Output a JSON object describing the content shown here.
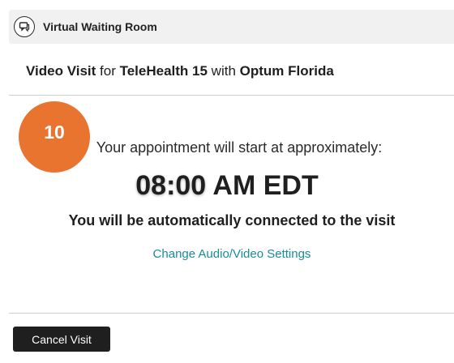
{
  "top_strip": {
    "text": "Virtual Waiting Room"
  },
  "header": {
    "title": "Virtual Waiting Room",
    "icon": "chat-bubble-icon"
  },
  "visit": {
    "type": "Video Visit",
    "for_word": " for ",
    "provider": "TeleHealth 15",
    "with_word": " with ",
    "organization": "Optum Florida"
  },
  "badge": {
    "number": "10",
    "color": "#e8742f"
  },
  "appointment": {
    "message": "Your appointment will start at approximately:",
    "time_number": "08:00",
    "time_suffix": " AM EDT",
    "auto_connect": "You will be automatically connected to the visit"
  },
  "links": {
    "settings": "Change Audio/Video Settings"
  },
  "buttons": {
    "cancel": "Cancel Visit"
  },
  "colors": {
    "link": "#1a8a9c",
    "header_bg": "#f1f1f1",
    "button_bg": "#1f1f1f"
  }
}
